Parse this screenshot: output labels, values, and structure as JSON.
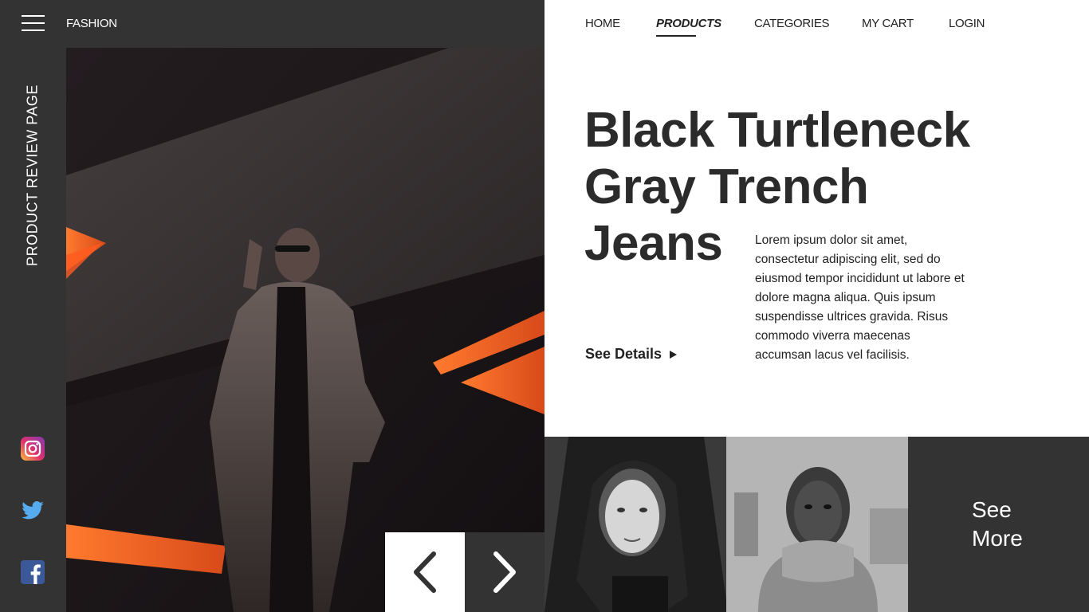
{
  "header": {
    "brand": "FASHION",
    "menu_icon": "hamburger-menu-icon"
  },
  "sidebar": {
    "vertical_label": "PRODUCT REVIEW PAGE",
    "social": [
      {
        "name": "instagram-icon",
        "color": "#e1306c"
      },
      {
        "name": "twitter-icon",
        "color": "#55acee"
      },
      {
        "name": "facebook-icon",
        "color": "#3b5998"
      }
    ]
  },
  "nav": {
    "items": [
      {
        "label": "HOME",
        "active": false
      },
      {
        "label": "PRODUCTS",
        "active": true
      },
      {
        "label": "CATEGORIES",
        "active": false
      },
      {
        "label": "MY CART",
        "active": false
      },
      {
        "label": "LOGIN",
        "active": false
      }
    ]
  },
  "product": {
    "title_lines": [
      "Black Turtleneck",
      "Gray Trench",
      "Jeans"
    ],
    "description": "Lorem ipsum dolor sit amet, consectetur adipiscing elit, sed do eiusmod tempor incididunt ut labore et dolore magna aliqua. Quis ipsum suspendisse ultrices gravida. Risus commodo viverra maecenas accumsan lacus vel facilisis.",
    "cta": "See Details"
  },
  "carousel": {
    "prev_icon": "chevron-left-icon",
    "next_icon": "chevron-right-icon"
  },
  "gallery": {
    "see_more_line1": "See",
    "see_more_line2": "More"
  },
  "colors": {
    "dark": "#333333",
    "accent": "#ff5a1f",
    "text": "#222222"
  }
}
